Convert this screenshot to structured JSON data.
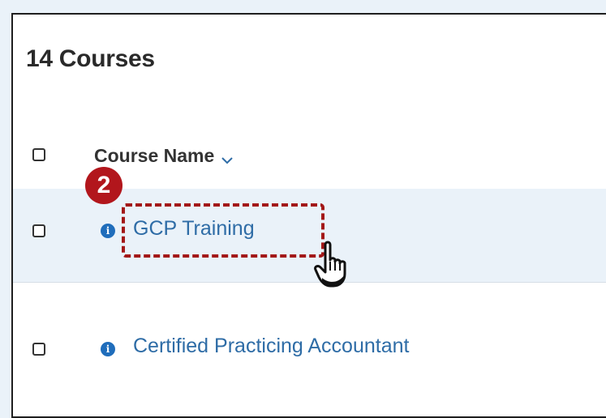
{
  "header": {
    "title": "14 Courses"
  },
  "table": {
    "column_header": "Course Name",
    "rows": [
      {
        "name": "GCP Training",
        "info_icon": "info-circle-icon"
      },
      {
        "name": "Certified Practicing Accountant",
        "info_icon": "info-circle-icon"
      }
    ]
  },
  "annotation": {
    "step_number": "2",
    "highlight_color": "#a31818"
  },
  "colors": {
    "page_bg": "#eaf2f9",
    "link": "#2e6ca6",
    "info_icon": "#1f6dbb",
    "selected_row_bg": "#eaf2f9",
    "step_badge": "#b2161c"
  }
}
